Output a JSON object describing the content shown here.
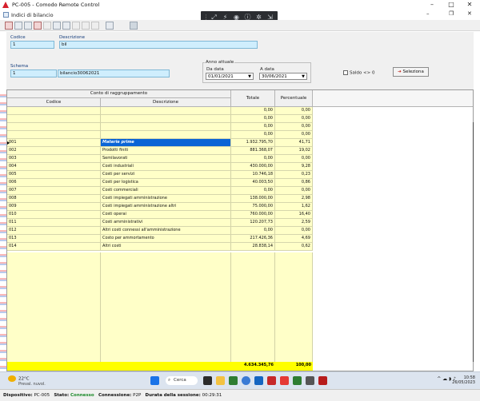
{
  "remote_window": {
    "title": "PC-005 - Comodo Remote Control",
    "min_glyph": "–",
    "max_glyph": "□",
    "close_glyph": "✕"
  },
  "app_window": {
    "title": "Indici di bilancio",
    "min_glyph": "–",
    "restore_glyph": "❐",
    "close_glyph": "✕"
  },
  "form": {
    "codice_label": "Codice",
    "codice_value": "1",
    "descrizione_label": "Descrizione",
    "descrizione_value": "bil",
    "schema_label": "Schema",
    "schema_code": "1",
    "schema_desc": "bilancio30062021",
    "anno_group_label": "Anno attuale",
    "da_data_label": "Da data",
    "da_data_value": "01/01/2021",
    "a_data_label": "A data",
    "a_data_value": "30/06/2021",
    "saldo_label": "Saldo <> 0",
    "seleziona_label": "Seleziona"
  },
  "table": {
    "group_header": "Conto di raggruppamento",
    "col_codice": "Codice",
    "col_descrizione": "Descrizione",
    "col_totale": "Totale",
    "col_percentuale": "Percentuale",
    "rows": [
      {
        "codice": "",
        "descrizione": "",
        "totale": "0,00",
        "perc": "0,00"
      },
      {
        "codice": "",
        "descrizione": "",
        "totale": "0,00",
        "perc": "0,00"
      },
      {
        "codice": "",
        "descrizione": "",
        "totale": "0,00",
        "perc": "0,00"
      },
      {
        "codice": "",
        "descrizione": "",
        "totale": "0,00",
        "perc": "0,00"
      },
      {
        "codice": "001",
        "descrizione": "Materie prime",
        "totale": "1.932.795,70",
        "perc": "41,71"
      },
      {
        "codice": "002",
        "descrizione": "Prodotti finiti",
        "totale": "881.368,07",
        "perc": "19,02"
      },
      {
        "codice": "003",
        "descrizione": "Semilavorati",
        "totale": "0,00",
        "perc": "0,00"
      },
      {
        "codice": "004",
        "descrizione": "Costi industriali",
        "totale": "430.000,00",
        "perc": "9,28"
      },
      {
        "codice": "005",
        "descrizione": "Costi per servizi",
        "totale": "10.746,18",
        "perc": "0,23"
      },
      {
        "codice": "006",
        "descrizione": "Costi per logistica",
        "totale": "40.003,50",
        "perc": "0,86"
      },
      {
        "codice": "007",
        "descrizione": "Costi commerciali",
        "totale": "0,00",
        "perc": "0,00"
      },
      {
        "codice": "008",
        "descrizione": "Costi impiegati amministrazione",
        "totale": "138.000,00",
        "perc": "2,98"
      },
      {
        "codice": "009",
        "descrizione": "Costi impiegati amministrazione altri",
        "totale": "75.000,00",
        "perc": "1,62"
      },
      {
        "codice": "010",
        "descrizione": "Costi operai",
        "totale": "760.000,00",
        "perc": "16,40"
      },
      {
        "codice": "011",
        "descrizione": "Costi amministrativi",
        "totale": "120.207,73",
        "perc": "2,59"
      },
      {
        "codice": "012",
        "descrizione": "Altri costi connessi all'amministrazione",
        "totale": "0,00",
        "perc": "0,00"
      },
      {
        "codice": "013",
        "descrizione": "Costo per ammortamento",
        "totale": "217.426,36",
        "perc": "4,69"
      },
      {
        "codice": "014",
        "descrizione": "Altri costi",
        "totale": "28.838,14",
        "perc": "0,62"
      }
    ],
    "total_value": "4.634.345,76",
    "total_perc": "100,00"
  },
  "taskbar": {
    "temperature": "22°C",
    "weather_desc": "Preval. nuvol.",
    "search_label": "Cerca",
    "time": "10:58",
    "date": "26/05/2023"
  },
  "statusbar": {
    "dispositivo_label": "Dispositivo:",
    "dispositivo_value": "PC-005",
    "stato_label": "Stato:",
    "stato_value": "Connesso",
    "connessione_label": "Connessione:",
    "connessione_value": "P2P",
    "durata_label": "Durata della sessione:",
    "durata_value": "00:29:31"
  },
  "colors": {
    "field_bg": "#cfeefd",
    "row_yellow": "#ffffc8",
    "total_yellow": "#ffff00",
    "selection_blue": "#0a64d6",
    "taskbar_bg": "#dce4ef"
  },
  "icons": [
    "comodo-logo-icon",
    "window-icon",
    "delete-icon",
    "print-icon",
    "search-icon",
    "zoom-icon",
    "first-record-icon",
    "last-record-icon",
    "excel-icon",
    "weather-sun-icon",
    "windows-start-icon",
    "search-icon",
    "wifi-icon",
    "volume-icon",
    "battery-icon"
  ]
}
